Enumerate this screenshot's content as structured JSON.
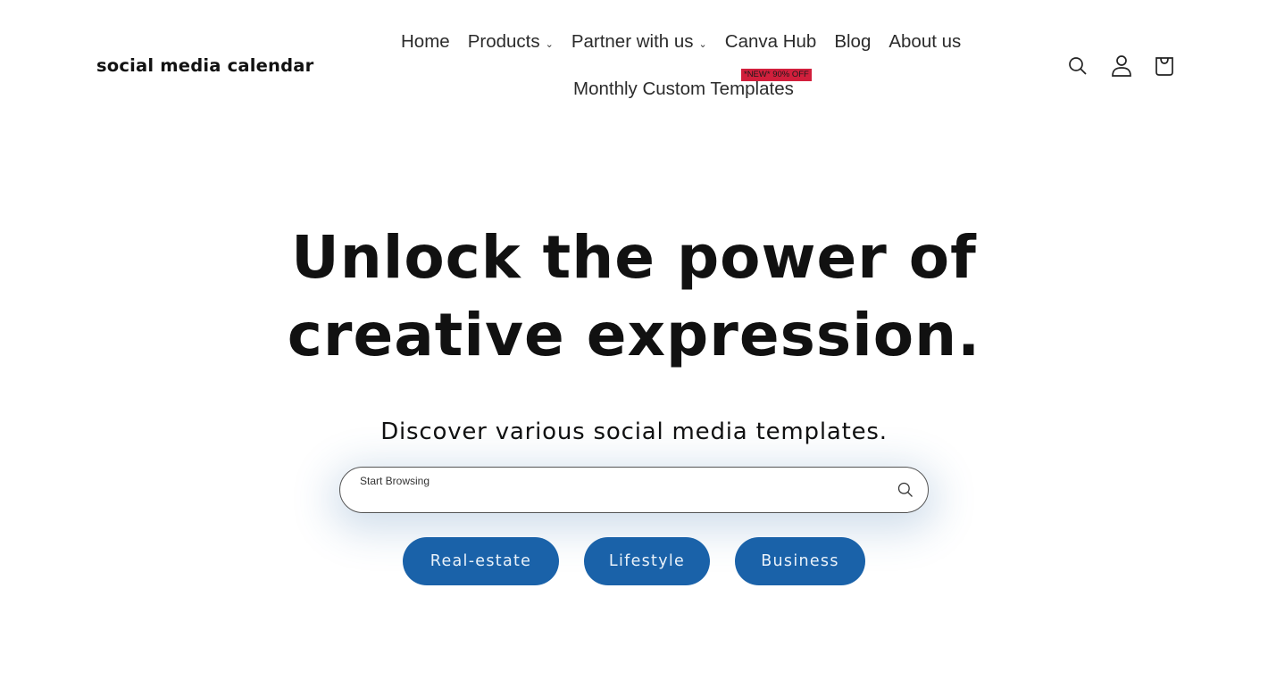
{
  "header": {
    "logo": "social media calendar",
    "nav": [
      {
        "label": "Home",
        "has_dropdown": false
      },
      {
        "label": "Products",
        "has_dropdown": true
      },
      {
        "label": "Partner with us",
        "has_dropdown": true
      },
      {
        "label": "Canva Hub",
        "has_dropdown": false
      },
      {
        "label": "Blog",
        "has_dropdown": false
      },
      {
        "label": "About us",
        "has_dropdown": false
      }
    ],
    "nav_second_row": {
      "label": "Monthly Custom Templates",
      "badge": "*NEW* 90% OFF"
    },
    "dropdown_glyph": "⌄",
    "icons": [
      "search-icon",
      "account-icon",
      "cart-icon"
    ]
  },
  "hero": {
    "title_line1": "Unlock the power of",
    "title_line2": "creative expression.",
    "subtitle": "Discover various social media templates."
  },
  "search": {
    "placeholder": "Start Browsing",
    "value": ""
  },
  "categories": [
    {
      "label": "Real-estate"
    },
    {
      "label": "Lifestyle"
    },
    {
      "label": "Business"
    }
  ],
  "colors": {
    "primary_button": "#1a62a9",
    "badge": "#d11f3c",
    "text": "#121212"
  }
}
